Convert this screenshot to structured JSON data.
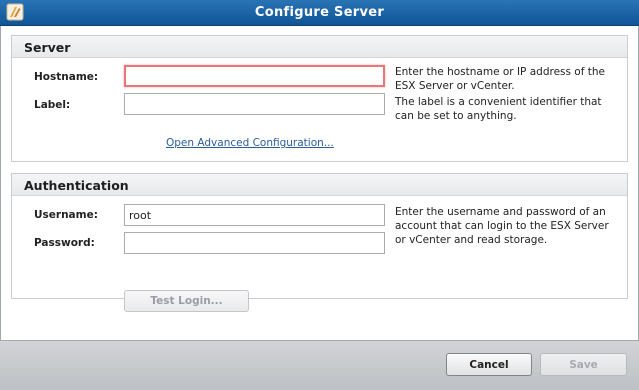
{
  "window": {
    "title": "Configure Server",
    "icon": "app-logo-icon"
  },
  "server": {
    "heading": "Server",
    "hostname_label": "Hostname:",
    "hostname_value": "",
    "label_label": "Label:",
    "label_value": "",
    "hostname_help": "Enter the hostname or IP address of the ESX Server or vCenter.",
    "label_help": "The label is a convenient identifier that can be set to anything.",
    "advanced_link": "Open Advanced Configuration..."
  },
  "auth": {
    "heading": "Authentication",
    "username_label": "Username:",
    "username_value": "root",
    "password_label": "Password:",
    "password_value": "",
    "help": "Enter the username and password of an account that can login to the ESX Server or vCenter and read storage.",
    "test_login_label": "Test Login..."
  },
  "footer": {
    "cancel_label": "Cancel",
    "save_label": "Save"
  },
  "colors": {
    "titlebar": "#1a64a8",
    "focus_border": "#e8777a",
    "link": "#2a5d9a"
  }
}
